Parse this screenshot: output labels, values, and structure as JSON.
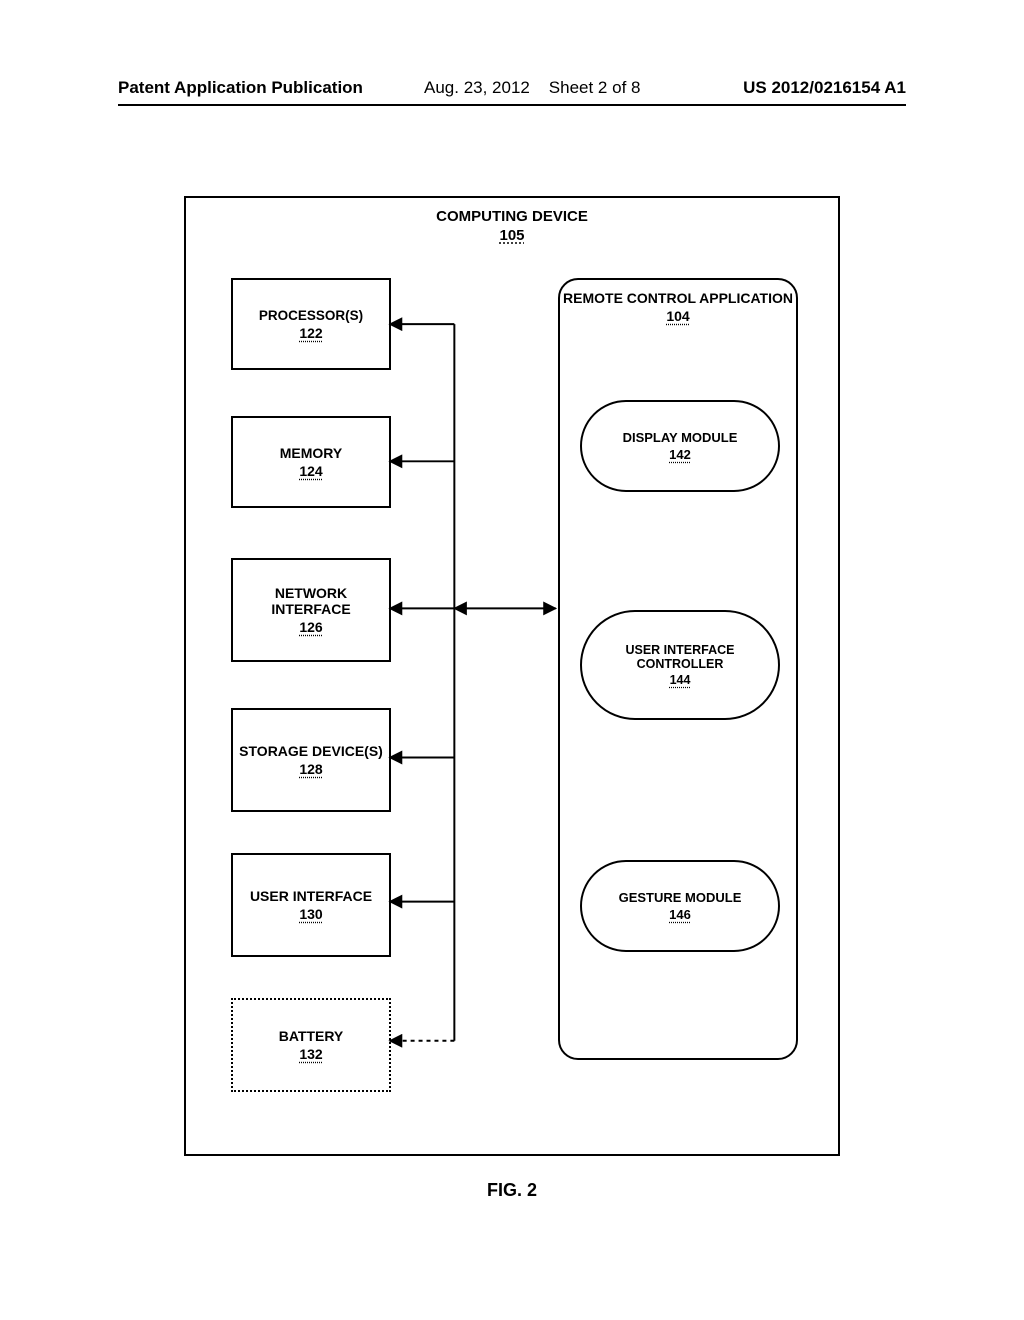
{
  "header": {
    "left": "Patent Application Publication",
    "mid_date": "Aug. 23, 2012",
    "mid_sheet": "Sheet 2 of 8",
    "right": "US 2012/0216154 A1"
  },
  "container": {
    "title": "COMPUTING DEVICE",
    "ref": "105"
  },
  "left_boxes": {
    "processor": {
      "label": "PROCESSOR(S)",
      "ref": "122"
    },
    "memory": {
      "label": "MEMORY",
      "ref": "124"
    },
    "network": {
      "label": "NETWORK INTERFACE",
      "ref": "126"
    },
    "storage": {
      "label": "STORAGE DEVICE(S)",
      "ref": "128"
    },
    "ui": {
      "label": "USER INTERFACE",
      "ref": "130"
    },
    "battery": {
      "label": "BATTERY",
      "ref": "132"
    }
  },
  "app_box": {
    "title": "REMOTE CONTROL APPLICATION",
    "ref": "104"
  },
  "modules": {
    "display": {
      "label": "DISPLAY MODULE",
      "ref": "142"
    },
    "uic": {
      "label": "USER INTERFACE CONTROLLER",
      "ref": "144"
    },
    "gesture": {
      "label": "GESTURE MODULE",
      "ref": "146"
    }
  },
  "caption": "FIG. 2"
}
